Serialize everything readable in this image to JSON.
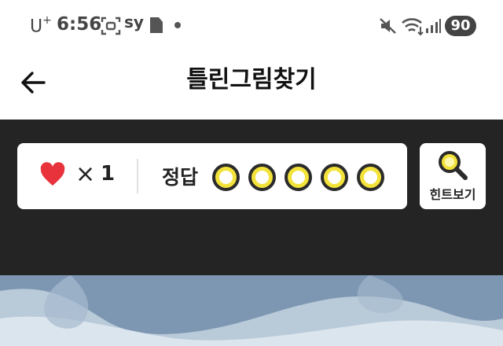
{
  "status_bar": {
    "carrier": "U",
    "carrier_sup": "+",
    "time": "6:56",
    "notif_text": "sy",
    "battery": "90"
  },
  "app_bar": {
    "title": "틀린그림찾기",
    "back_icon": "arrow-left-icon"
  },
  "game": {
    "lives_symbol": "×",
    "lives_count": "1",
    "answer_label": "정답",
    "answers_found": 0,
    "answers_total": 5,
    "slot_color": "#f2e23a",
    "hint_label": "힌트보기",
    "hint_icon": "magnifier-icon",
    "heart_color": "#e8323c"
  },
  "colors": {
    "header_bg": "#242424",
    "card_bg": "#ffffff"
  }
}
